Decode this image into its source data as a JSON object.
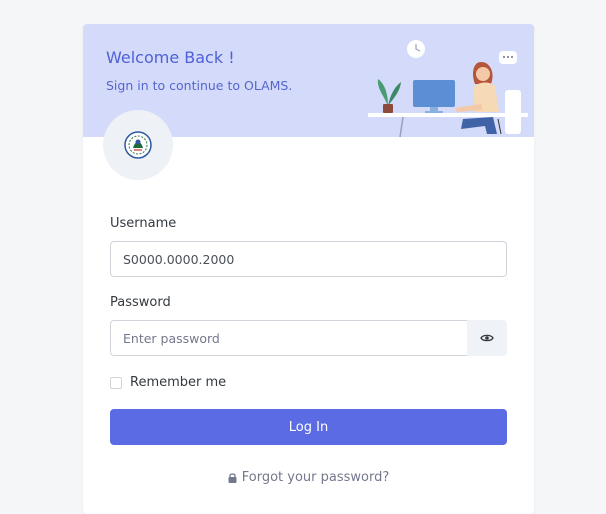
{
  "header": {
    "title": "Welcome Back !",
    "subtitle": "Sign in to continue to OLAMS."
  },
  "form": {
    "username_label": "Username",
    "username_value": "S0000.0000.2000",
    "password_label": "Password",
    "password_placeholder": "Enter password",
    "remember_label": "Remember me",
    "login_label": "Log In",
    "forgot_label": "Forgot your password?"
  },
  "icons": {
    "logo": "university-seal-icon",
    "password_toggle": "eye-icon",
    "forgot": "lock-icon",
    "illustration": "person-at-desk-illustration"
  },
  "colors": {
    "accent": "#5b6be3",
    "banner": "#d4dafa",
    "heading": "#4f61d6"
  }
}
